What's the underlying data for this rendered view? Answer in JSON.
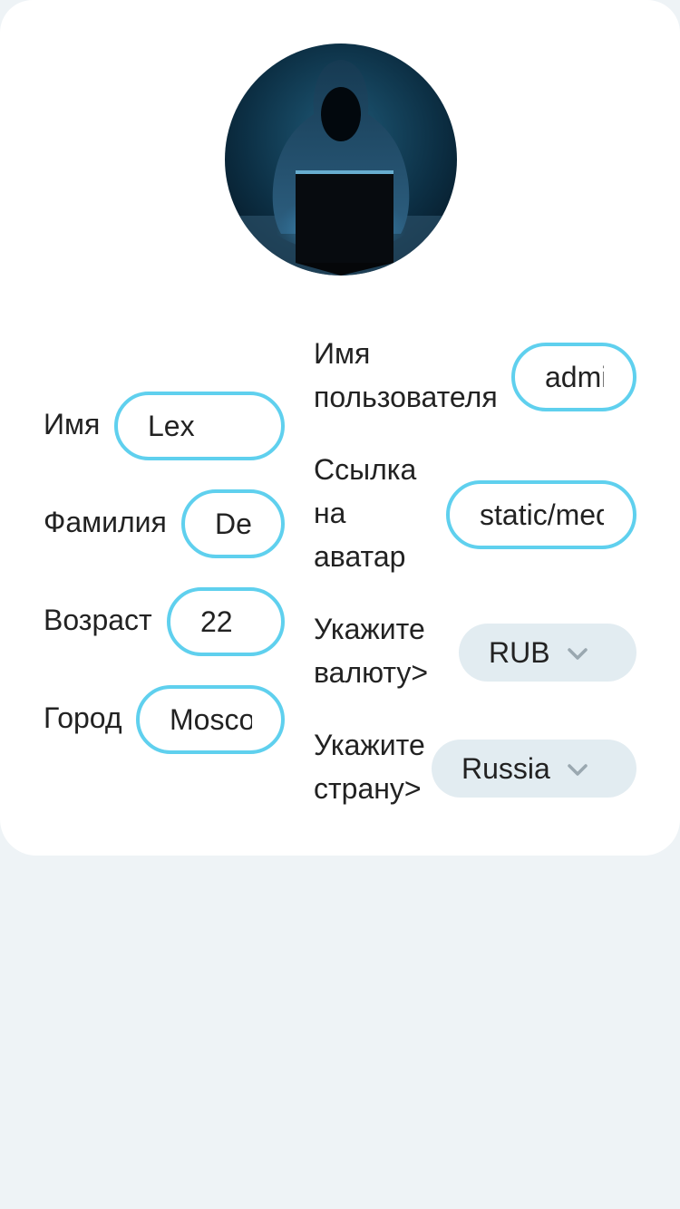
{
  "profile": {
    "avatar_icon": "hooded-hacker-avatar",
    "fields": {
      "first_name": {
        "label": "Имя",
        "value": "Lex"
      },
      "last_name": {
        "label": "Фамилия",
        "value": "Dev"
      },
      "age": {
        "label": "Возраст",
        "value": "22"
      },
      "city": {
        "label": "Город",
        "value": "Moscow"
      },
      "username": {
        "label_line1": "Имя",
        "label_line2": "пользователя",
        "value": "admin"
      },
      "avatar_link": {
        "label_line1": "Ссылка",
        "label_line2": "на",
        "label_line3": "аватар",
        "value": "static/media/avatar.jpg"
      },
      "currency": {
        "label_line1": "Укажите",
        "label_line2": "валюту>",
        "value": "RUB"
      },
      "country": {
        "label_line1": "Укажите",
        "label_line2": "страну>",
        "value": "Russia"
      }
    }
  },
  "colors": {
    "accent_border": "#5fd0ee",
    "select_bg": "#e2ecf1",
    "page_bg": "#eef3f6",
    "card_bg": "#ffffff"
  }
}
